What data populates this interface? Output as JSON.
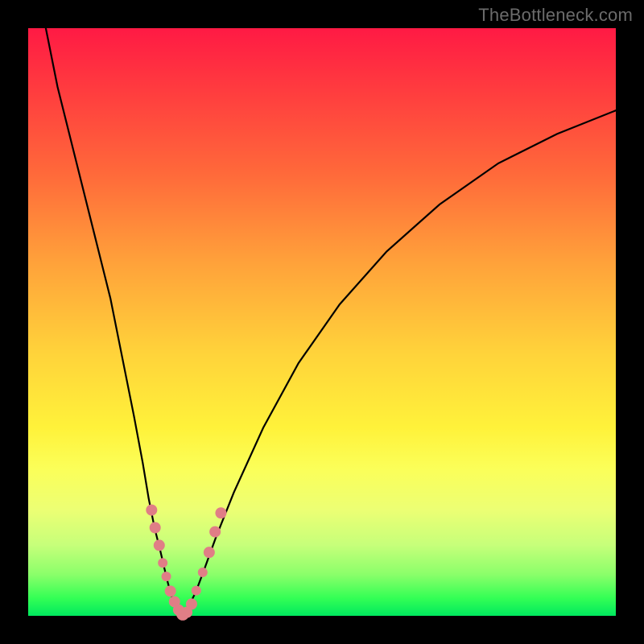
{
  "watermark": "TheBottleneck.com",
  "colors": {
    "background": "#000000",
    "curve": "#000000",
    "marker_fill": "#e07e86",
    "marker_stroke": "#d46a72"
  },
  "chart_data": {
    "type": "line",
    "title": "",
    "xlabel": "",
    "ylabel": "",
    "xlim": [
      0,
      100
    ],
    "ylim": [
      0,
      100
    ],
    "grid": false,
    "series": [
      {
        "name": "left-branch",
        "x": [
          3,
          5,
          8,
          11,
          14,
          16,
          18,
          19.5,
          20.5,
          21.5,
          22.5,
          23.2,
          23.8,
          24.3,
          24.8,
          25.3,
          25.7,
          26.0
        ],
        "y": [
          100,
          90,
          78,
          66,
          54,
          44,
          34,
          26,
          20,
          15,
          11,
          8,
          5.5,
          3.7,
          2.2,
          1.1,
          0.4,
          0.0
        ]
      },
      {
        "name": "right-branch",
        "x": [
          26.0,
          26.6,
          27.4,
          28.5,
          30,
          32,
          35,
          40,
          46,
          53,
          61,
          70,
          80,
          90,
          100
        ],
        "y": [
          0.0,
          0.6,
          1.8,
          4.0,
          8.0,
          13.5,
          21,
          32,
          43,
          53,
          62,
          70,
          77,
          82,
          86
        ]
      }
    ],
    "markers": {
      "name": "cluster-points",
      "points": [
        {
          "x": 21.0,
          "y": 18.0,
          "r": 7
        },
        {
          "x": 21.6,
          "y": 15.0,
          "r": 7
        },
        {
          "x": 22.3,
          "y": 12.0,
          "r": 7
        },
        {
          "x": 22.9,
          "y": 9.0,
          "r": 6
        },
        {
          "x": 23.5,
          "y": 6.7,
          "r": 6
        },
        {
          "x": 24.2,
          "y": 4.2,
          "r": 7
        },
        {
          "x": 24.9,
          "y": 2.4,
          "r": 7
        },
        {
          "x": 25.6,
          "y": 1.0,
          "r": 7
        },
        {
          "x": 26.3,
          "y": 0.3,
          "r": 8
        },
        {
          "x": 27.0,
          "y": 0.6,
          "r": 7
        },
        {
          "x": 27.8,
          "y": 2.0,
          "r": 7
        },
        {
          "x": 28.6,
          "y": 4.3,
          "r": 6
        },
        {
          "x": 29.7,
          "y": 7.4,
          "r": 6
        },
        {
          "x": 30.8,
          "y": 10.8,
          "r": 7
        },
        {
          "x": 31.8,
          "y": 14.3,
          "r": 7
        },
        {
          "x": 32.8,
          "y": 17.5,
          "r": 7
        }
      ]
    }
  }
}
